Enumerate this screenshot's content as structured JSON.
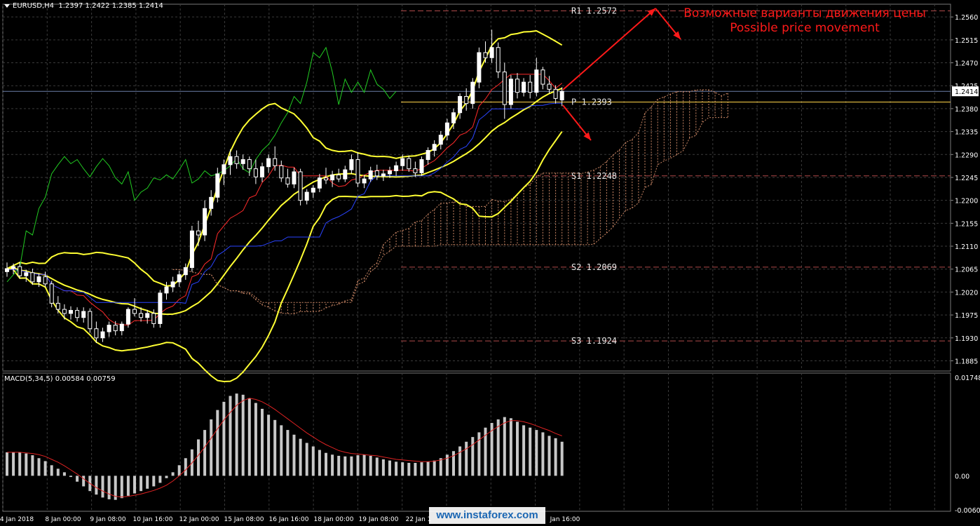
{
  "header": {
    "symbol": "EURUSD,H4",
    "ohlc": "1.2397 1.2422 1.2385 1.2414"
  },
  "annotation": {
    "ru": "Возможные варианты движения цены",
    "en": "Possible price movement"
  },
  "watermark": "www.instaforex.com",
  "colors": {
    "background": "#000000",
    "grid": "#3a3a3a",
    "bull_candle": "#ffffff",
    "bear_candle": "#000000",
    "bollinger": "#ffff33",
    "ma_red": "#ff2a2a",
    "ma_blue": "#2a44ff",
    "chikou": "#22cc22",
    "cloud": "#cc8866",
    "annotation": "#ff1a1a",
    "pivot_line": "#ffd54a",
    "macd_hist": "#c8c8c8",
    "macd_signal": "#dd2222"
  },
  "chart_data": [
    {
      "type": "candlestick",
      "title": "EURUSD,H4",
      "ylim": [
        1.1865,
        1.2585
      ],
      "y_ticks": [
        "1.2560",
        "1.2515",
        "1.2470",
        "1.2425",
        "1.2380",
        "1.2335",
        "1.2290",
        "1.2245",
        "1.2200",
        "1.2155",
        "1.2110",
        "1.2065",
        "1.2020",
        "1.1975",
        "1.1930",
        "1.1885"
      ],
      "x_labels": [
        "4 Jan 2018",
        "8 Jan 00:00",
        "9 Jan 08:00",
        "10 Jan 16:00",
        "12 Jan 00:00",
        "15 Jan 08:00",
        "16 Jan 16:00",
        "18 Jan 00:00",
        "19 Jan 08:00",
        "22 Jan 1",
        "",
        "Jan 16:00"
      ],
      "current_price": "1.2414",
      "levels": [
        {
          "label": "R1",
          "value": "1.2572"
        },
        {
          "label": "P",
          "value": "1.2393"
        },
        {
          "label": "S1",
          "value": "1.2248"
        },
        {
          "label": "S2",
          "value": "1.2069"
        },
        {
          "label": "S3",
          "value": "1.1924"
        }
      ],
      "candles": [
        [
          1.206,
          1.2078,
          1.205,
          1.2066
        ],
        [
          1.2066,
          1.2076,
          1.2055,
          1.207
        ],
        [
          1.207,
          1.2079,
          1.2046,
          1.2052
        ],
        [
          1.2052,
          1.2064,
          1.204,
          1.2058
        ],
        [
          1.2058,
          1.2066,
          1.2034,
          1.204
        ],
        [
          1.204,
          1.2056,
          1.203,
          1.205
        ],
        [
          1.205,
          1.206,
          1.203,
          1.2036
        ],
        [
          1.2036,
          1.2042,
          1.199,
          1.1998
        ],
        [
          1.1998,
          1.2012,
          1.1978,
          1.1986
        ],
        [
          1.1986,
          1.1996,
          1.1966,
          1.1978
        ],
        [
          1.1978,
          1.1992,
          1.1966,
          1.1984
        ],
        [
          1.1984,
          1.199,
          1.1962,
          1.197
        ],
        [
          1.197,
          1.199,
          1.196,
          1.1982
        ],
        [
          1.1982,
          1.1988,
          1.194,
          1.1948
        ],
        [
          1.1948,
          1.1962,
          1.192,
          1.193
        ],
        [
          1.193,
          1.195,
          1.1922,
          1.1942
        ],
        [
          1.1942,
          1.1962,
          1.1932,
          1.1955
        ],
        [
          1.1955,
          1.1963,
          1.1935,
          1.1944
        ],
        [
          1.1944,
          1.1962,
          1.1935,
          1.1957
        ],
        [
          1.1957,
          1.199,
          1.195,
          1.1986
        ],
        [
          1.1986,
          1.2008,
          1.1972,
          1.1978
        ],
        [
          1.1978,
          1.199,
          1.1962,
          1.197
        ],
        [
          1.197,
          1.1985,
          1.1958,
          1.1978
        ],
        [
          1.1978,
          1.1986,
          1.195,
          1.1958
        ],
        [
          1.1958,
          1.2024,
          1.195,
          1.2018
        ],
        [
          1.2018,
          1.204,
          1.2005,
          1.203
        ],
        [
          1.203,
          1.205,
          1.202,
          1.204
        ],
        [
          1.204,
          1.2062,
          1.203,
          1.2054
        ],
        [
          1.2054,
          1.2076,
          1.2044,
          1.2068
        ],
        [
          1.2068,
          1.215,
          1.206,
          1.214
        ],
        [
          1.214,
          1.216,
          1.211,
          1.2132
        ],
        [
          1.2132,
          1.22,
          1.212,
          1.2184
        ],
        [
          1.2184,
          1.222,
          1.217,
          1.2206
        ],
        [
          1.2206,
          1.2264,
          1.2196,
          1.2252
        ],
        [
          1.2252,
          1.228,
          1.223,
          1.227
        ],
        [
          1.227,
          1.23,
          1.225,
          1.2286
        ],
        [
          1.2286,
          1.2298,
          1.2262,
          1.2272
        ],
        [
          1.2272,
          1.229,
          1.226,
          1.228
        ],
        [
          1.228,
          1.2286,
          1.2248,
          1.2262
        ],
        [
          1.2262,
          1.228,
          1.2232,
          1.2246
        ],
        [
          1.2246,
          1.2274,
          1.2236,
          1.2266
        ],
        [
          1.2266,
          1.229,
          1.2254,
          1.2282
        ],
        [
          1.2282,
          1.2306,
          1.2258,
          1.2268
        ],
        [
          1.2268,
          1.2278,
          1.2236,
          1.2244
        ],
        [
          1.2244,
          1.2262,
          1.2225,
          1.2232
        ],
        [
          1.2232,
          1.2264,
          1.2224,
          1.2256
        ],
        [
          1.2256,
          1.2262,
          1.219,
          1.22
        ],
        [
          1.22,
          1.2222,
          1.2192,
          1.2216
        ],
        [
          1.2216,
          1.223,
          1.2205,
          1.2224
        ],
        [
          1.2224,
          1.2252,
          1.2216,
          1.2244
        ],
        [
          1.2244,
          1.2264,
          1.2232,
          1.224
        ],
        [
          1.224,
          1.2258,
          1.2226,
          1.225
        ],
        [
          1.225,
          1.2262,
          1.2236,
          1.2242
        ],
        [
          1.2242,
          1.2268,
          1.2236,
          1.226
        ],
        [
          1.226,
          1.229,
          1.2252,
          1.228
        ],
        [
          1.228,
          1.2294,
          1.2226,
          1.2234
        ],
        [
          1.2234,
          1.225,
          1.2224,
          1.2242
        ],
        [
          1.2242,
          1.2266,
          1.2236,
          1.2258
        ],
        [
          1.2258,
          1.227,
          1.224,
          1.2248
        ],
        [
          1.2248,
          1.226,
          1.2238,
          1.2252
        ],
        [
          1.2252,
          1.2266,
          1.2244,
          1.2258
        ],
        [
          1.2258,
          1.2276,
          1.2248,
          1.2268
        ],
        [
          1.2268,
          1.229,
          1.2258,
          1.2282
        ],
        [
          1.2282,
          1.2288,
          1.2256,
          1.2262
        ],
        [
          1.2262,
          1.2276,
          1.2246,
          1.2254
        ],
        [
          1.2254,
          1.2286,
          1.2248,
          1.228
        ],
        [
          1.228,
          1.2304,
          1.227,
          1.2298
        ],
        [
          1.2298,
          1.2318,
          1.2286,
          1.231
        ],
        [
          1.231,
          1.2336,
          1.23,
          1.2328
        ],
        [
          1.2328,
          1.236,
          1.2318,
          1.2352
        ],
        [
          1.2352,
          1.238,
          1.234,
          1.2372
        ],
        [
          1.2372,
          1.241,
          1.236,
          1.2404
        ],
        [
          1.2404,
          1.242,
          1.2376,
          1.239
        ],
        [
          1.239,
          1.244,
          1.238,
          1.2432
        ],
        [
          1.2432,
          1.25,
          1.242,
          1.249
        ],
        [
          1.249,
          1.2512,
          1.247,
          1.248
        ],
        [
          1.248,
          1.2535,
          1.247,
          1.25
        ],
        [
          1.25,
          1.251,
          1.244,
          1.2452
        ],
        [
          1.2452,
          1.247,
          1.236,
          1.2388
        ],
        [
          1.2388,
          1.2446,
          1.238,
          1.2438
        ],
        [
          1.2438,
          1.245,
          1.24,
          1.2412
        ],
        [
          1.2412,
          1.244,
          1.2404,
          1.2432
        ],
        [
          1.2432,
          1.2446,
          1.24,
          1.2412
        ],
        [
          1.2412,
          1.248,
          1.2404,
          1.2456
        ],
        [
          1.2456,
          1.2462,
          1.2418,
          1.2428
        ],
        [
          1.2428,
          1.2444,
          1.241,
          1.2418
        ],
        [
          1.2418,
          1.2426,
          1.239,
          1.24
        ],
        [
          1.2397,
          1.2422,
          1.2385,
          1.2414
        ]
      ]
    },
    {
      "type": "bar",
      "title": "MACD(5,34,5) 0.00584 0.00759",
      "ylim": [
        -0.00604,
        0.01748
      ],
      "y_ticks": [
        "0.01748",
        "0.00",
        "-0.00604"
      ],
      "values": [
        0.004,
        0.004,
        0.004,
        0.0038,
        0.0035,
        0.003,
        0.0025,
        0.0018,
        0.0012,
        0.0006,
        -0.0002,
        -0.001,
        -0.0018,
        -0.0026,
        -0.0032,
        -0.0037,
        -0.004,
        -0.0041,
        -0.0038,
        -0.0034,
        -0.003,
        -0.0026,
        -0.0022,
        -0.0018,
        -0.0012,
        -0.0004,
        0.0006,
        0.0018,
        0.003,
        0.0045,
        0.0062,
        0.0078,
        0.0096,
        0.0112,
        0.0126,
        0.0136,
        0.014,
        0.0138,
        0.0132,
        0.0124,
        0.0114,
        0.0104,
        0.0095,
        0.0086,
        0.0078,
        0.007,
        0.0063,
        0.0056,
        0.005,
        0.0044,
        0.0039,
        0.0036,
        0.0034,
        0.0033,
        0.0033,
        0.0035,
        0.0036,
        0.0034,
        0.0031,
        0.0028,
        0.0026,
        0.0024,
        0.0023,
        0.0022,
        0.0022,
        0.0023,
        0.0024,
        0.0026,
        0.003,
        0.0036,
        0.0042,
        0.005,
        0.0058,
        0.0066,
        0.0074,
        0.0082,
        0.009,
        0.0096,
        0.01,
        0.0098,
        0.0092,
        0.0086,
        0.0082,
        0.0078,
        0.0074,
        0.0068,
        0.0064,
        0.0058
      ],
      "signal": [
        0.004,
        0.004,
        0.004,
        0.0039,
        0.0038,
        0.0036,
        0.0033,
        0.0028,
        0.0023,
        0.0017,
        0.001,
        0.0003,
        -0.0005,
        -0.0013,
        -0.002,
        -0.0026,
        -0.0031,
        -0.0035,
        -0.0036,
        -0.0035,
        -0.0033,
        -0.0031,
        -0.0028,
        -0.0025,
        -0.0021,
        -0.0016,
        -0.0009,
        0.0,
        0.001,
        0.0022,
        0.0035,
        0.0049,
        0.0064,
        0.008,
        0.0095,
        0.0108,
        0.012,
        0.0128,
        0.0132,
        0.013,
        0.0126,
        0.012,
        0.0113,
        0.0105,
        0.0097,
        0.0089,
        0.0081,
        0.0073,
        0.0066,
        0.0059,
        0.0053,
        0.0048,
        0.0043,
        0.004,
        0.0038,
        0.0037,
        0.0036,
        0.0035,
        0.0034,
        0.0032,
        0.003,
        0.0028,
        0.0027,
        0.0026,
        0.0025,
        0.0024,
        0.0024,
        0.0025,
        0.0027,
        0.003,
        0.0034,
        0.004,
        0.0046,
        0.0053,
        0.0061,
        0.0069,
        0.0077,
        0.0084,
        0.009,
        0.0094,
        0.0094,
        0.0092,
        0.0089,
        0.0085,
        0.0081,
        0.0077,
        0.0072,
        0.0068
      ]
    }
  ]
}
